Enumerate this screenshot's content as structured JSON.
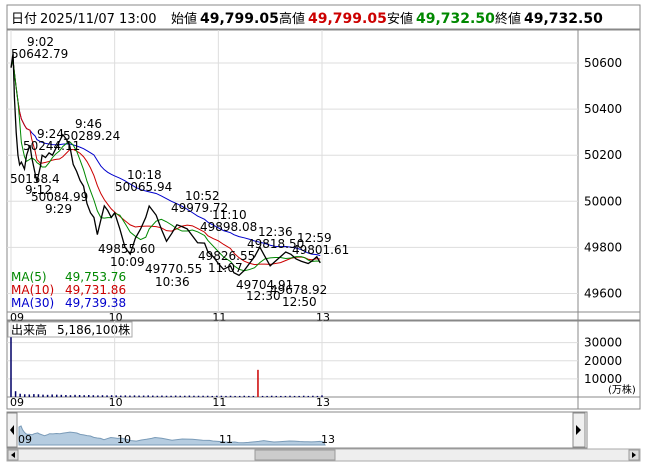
{
  "header": {
    "date_label": "日付",
    "date": "2025/11/07 13:00",
    "open_label": "始値",
    "open": "49,799.05",
    "high_label": "高値",
    "high": "49,799.05",
    "low_label": "安値",
    "low": "49,732.50",
    "close_label": "終値",
    "close": "49,732.50"
  },
  "colors": {
    "up": "#cc0000",
    "down": "#006600",
    "ma5": "#008800",
    "ma10": "#cc0000",
    "ma30": "#0000cc",
    "text": "#000000",
    "grid": "#dddddd",
    "border": "#888888",
    "price_line": "#000000",
    "volume": "#000066",
    "volume_spike": "#cc0000",
    "nav_fill": "#b5cce0"
  },
  "chart_data": [
    {
      "type": "line",
      "title": "",
      "x_tick_labels": [
        "09",
        "10",
        "11",
        "13"
      ],
      "x_ticks": [
        9.0,
        10.0,
        11.0,
        12.0
      ],
      "y_ticks": [
        49600,
        49800,
        50000,
        50200,
        50400,
        50600
      ],
      "y_tick_labels": [
        "49600",
        "49800",
        "50000",
        "50200",
        "50400",
        "50600"
      ],
      "ylim": [
        49550,
        50700
      ],
      "xlim": [
        9.0,
        12.0
      ],
      "grid": true,
      "series": [
        {
          "name": "",
          "x": [
            9.0,
            9.02,
            9.033,
            9.05,
            9.067,
            9.083,
            9.1,
            9.13,
            9.15,
            9.183,
            9.2,
            9.233,
            9.25,
            9.283,
            9.3,
            9.333,
            9.367,
            9.4,
            9.433,
            9.467,
            9.5,
            9.533,
            9.567,
            9.6,
            9.633,
            9.667,
            9.7,
            9.733,
            9.767,
            9.8,
            9.833,
            9.867,
            9.9,
            9.933,
            9.967,
            10.0,
            10.05,
            10.1,
            10.15,
            10.2,
            10.25,
            10.3,
            10.333,
            10.4,
            10.45,
            10.5,
            10.55,
            10.6,
            10.65,
            10.7,
            10.75,
            10.8,
            10.867,
            10.9,
            10.95,
            11.0,
            11.05,
            11.117,
            11.15,
            11.2,
            11.25,
            11.3,
            11.35,
            11.4,
            11.45,
            11.5,
            11.55,
            11.6,
            11.65,
            11.7,
            11.75,
            11.8,
            11.833,
            11.867,
            11.9,
            11.95,
            11.983
          ],
          "values": [
            50580,
            50642.79,
            50450,
            50300,
            50200,
            50158.4,
            50170,
            50140,
            50200,
            50244.11,
            50190,
            50120,
            50084.99,
            50150,
            50200,
            50190,
            50210,
            50200,
            50230,
            50260,
            50289.24,
            50270,
            50240,
            50160,
            50130,
            50090,
            50065.94,
            49990,
            49950,
            49930,
            49855.6,
            49920,
            49980,
            49960,
            49930,
            49950,
            49880,
            49800,
            49770.55,
            49840,
            49880,
            49930,
            49979.72,
            49940,
            49880,
            49826.55,
            49860,
            49898.08,
            49890,
            49880,
            49850,
            49820,
            49818.5,
            49780,
            49760,
            49730,
            49704.91,
            49720,
            49690,
            49678.92,
            49700,
            49730,
            49760,
            49801.61,
            49760,
            49720,
            49740,
            49760,
            49780,
            49770,
            49750,
            49740,
            49735,
            49730,
            49740,
            49760,
            49732.5
          ],
          "price_labels": [
            "50642.79",
            "50244.11",
            "50158.4",
            "50084.99",
            "50289.24",
            "50065.94",
            "49855.60",
            "49770.55",
            "49979.72",
            "49826.55",
            "49898.08",
            "49818.50",
            "49801.61",
            "49704.91",
            "49678.92"
          ],
          "time_labels": [
            "9:02",
            "9:24",
            "9:12",
            "9:29",
            "9:46",
            "10:18",
            "10:09",
            "10:36",
            "10:52",
            "11:07",
            "11:10",
            "12:36",
            "12:59",
            "12:30",
            "12:50"
          ]
        }
      ],
      "legend": [
        {
          "name": "MA(5)",
          "value": "49,753.76"
        },
        {
          "name": "MA(10)",
          "value": "49,731.86"
        },
        {
          "name": "MA(30)",
          "value": "49,739.38"
        }
      ],
      "legend_position": "bottom-left"
    },
    {
      "type": "bar",
      "title": "出来高",
      "value_label": "5,186,100株",
      "y_ticks": [
        10000,
        20000,
        30000
      ],
      "y_tick_labels": [
        "10000",
        "20000",
        "30000"
      ],
      "unit": "(万株)",
      "x_tick_labels": [
        "09",
        "10",
        "11",
        "13"
      ],
      "values": [
        33000,
        3200,
        1800,
        1500,
        1400,
        1600,
        1500,
        1300,
        1200,
        1400,
        1300,
        1200,
        1100,
        1000,
        1200,
        1100,
        1000,
        1100,
        1000,
        900,
        1000,
        900,
        1000,
        900,
        800,
        900,
        800,
        900,
        800,
        800,
        900,
        800,
        700,
        800,
        700,
        700,
        800,
        700,
        700,
        800,
        700,
        700,
        700,
        700,
        600,
        700,
        700,
        600,
        700,
        600,
        600,
        700,
        600,
        600,
        15000,
        600,
        600,
        700,
        600,
        600,
        600,
        700,
        600,
        600,
        700,
        600,
        700,
        600,
        900
      ]
    }
  ],
  "navigator": {
    "x_tick_labels": [
      "09",
      "10",
      "11",
      "13"
    ]
  }
}
